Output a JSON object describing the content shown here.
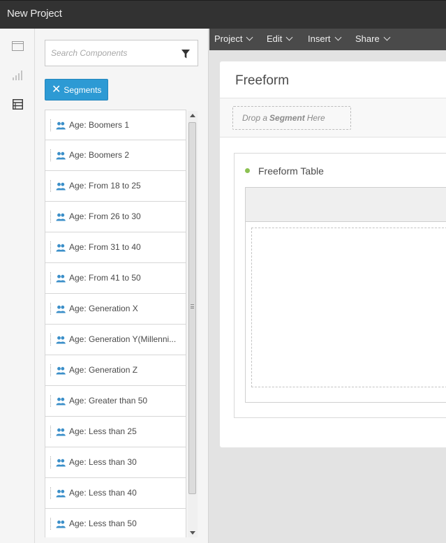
{
  "app": {
    "title": "New Project"
  },
  "rail": {
    "icons": [
      "panels-icon",
      "visualizations-icon",
      "components-icon"
    ]
  },
  "panel": {
    "search_placeholder": "Search Components",
    "filter_chip": {
      "remove_glyph": "✕",
      "label": "Segments"
    },
    "items": [
      {
        "label": "Age: Boomers 1"
      },
      {
        "label": "Age: Boomers 2"
      },
      {
        "label": "Age: From 18 to 25"
      },
      {
        "label": "Age: From 26 to 30"
      },
      {
        "label": "Age: From 31 to 40"
      },
      {
        "label": "Age: From 41 to 50"
      },
      {
        "label": "Age: Generation X"
      },
      {
        "label": "Age: Generation Y(Millenni..."
      },
      {
        "label": "Age: Generation Z"
      },
      {
        "label": "Age: Greater than 50"
      },
      {
        "label": "Age: Less than 25"
      },
      {
        "label": "Age: Less than 30"
      },
      {
        "label": "Age: Less than 40"
      },
      {
        "label": "Age: Less than 50"
      }
    ]
  },
  "menubar": {
    "items": [
      "Project",
      "Edit",
      "Insert",
      "Share"
    ]
  },
  "workspace": {
    "panel_title": "Freeform",
    "drop_segment": {
      "prefix": "Drop a",
      "strong": "Segment",
      "suffix": "Here"
    },
    "visualization": {
      "title": "Freeform Table",
      "status_color": "#8cc152"
    }
  },
  "colors": {
    "accent": "#2d9ad4",
    "titlebar": "#323232",
    "menubar": "#4a4a4a"
  }
}
